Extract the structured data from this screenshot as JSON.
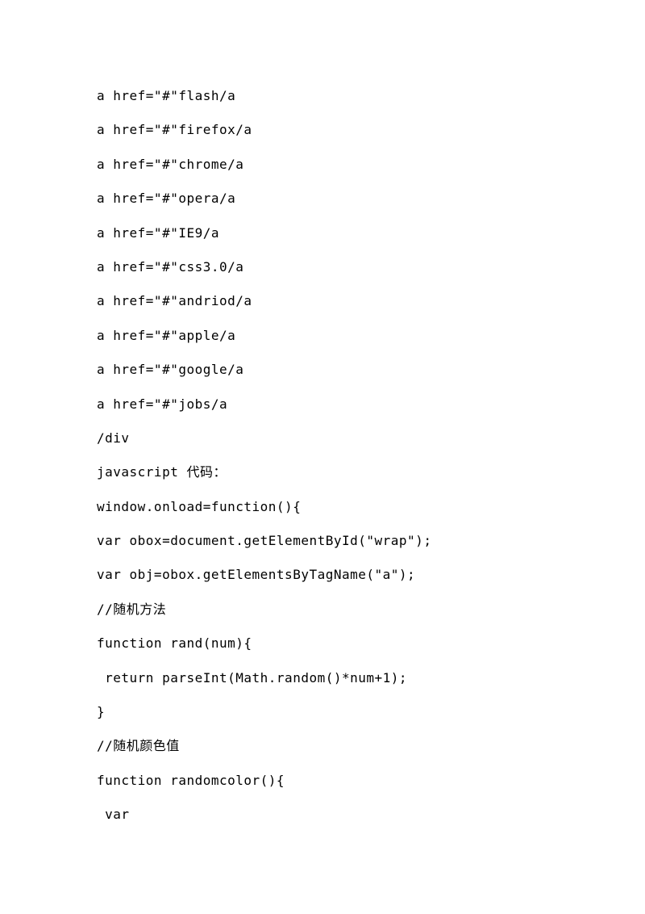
{
  "lines": [
    "a href=\"#\"flash/a",
    "a href=\"#\"firefox/a",
    "a href=\"#\"chrome/a",
    "a href=\"#\"opera/a",
    "a href=\"#\"IE9/a",
    "a href=\"#\"css3.0/a",
    "a href=\"#\"andriod/a",
    "a href=\"#\"apple/a",
    "a href=\"#\"google/a",
    "a href=\"#\"jobs/a",
    "/div",
    "javascript 代码：",
    "window.onload=function(){",
    "var obox=document.getElementById(\"wrap\");",
    "var obj=obox.getElementsByTagName(\"a\");",
    "//随机方法",
    "function rand(num){",
    " return parseInt(Math.random()*num+1);",
    "}",
    "//随机颜色值",
    "function randomcolor(){",
    " var"
  ]
}
